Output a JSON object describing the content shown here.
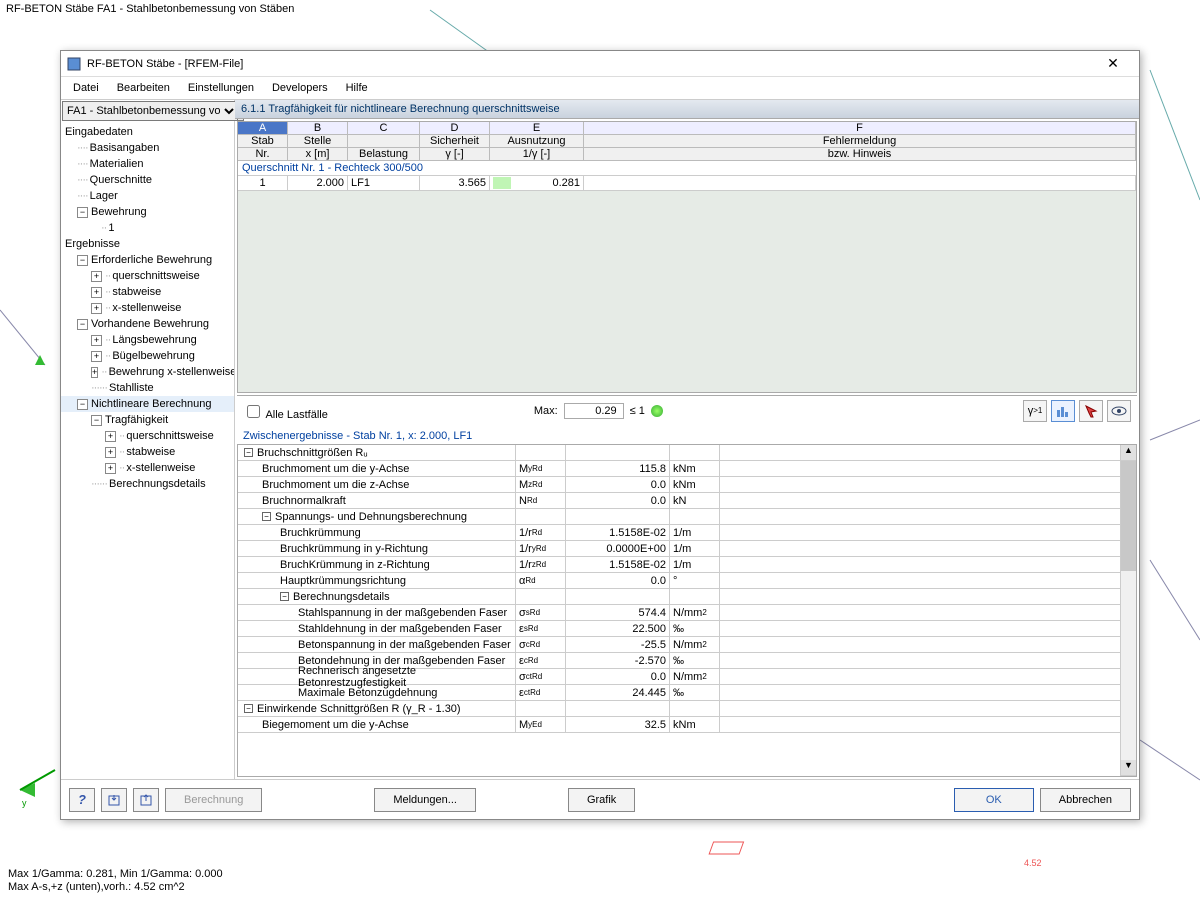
{
  "appTitle": "RF-BETON Stäbe FA1 - Stahlbetonbemessung von Stäben",
  "dialogTitle": "RF-BETON Stäbe - [RFEM-File]",
  "menus": [
    "Datei",
    "Bearbeiten",
    "Einstellungen",
    "Developers",
    "Hilfe"
  ],
  "caseSelect": "FA1 - Stahlbetonbemessung vo",
  "tree": {
    "eingabedaten": "Eingabedaten",
    "basisangaben": "Basisangaben",
    "materialien": "Materialien",
    "querschnitte": "Querschnitte",
    "lager": "Lager",
    "bewehrung": "Bewehrung",
    "bewehrung1": "1",
    "ergebnisse": "Ergebnisse",
    "erforderliche": "Erforderliche Bewehrung",
    "erf_q": "querschnittsweise",
    "erf_s": "stabweise",
    "erf_x": "x-stellenweise",
    "vorhandene": "Vorhandene Bewehrung",
    "vor_l": "Längsbewehrung",
    "vor_b": "Bügelbewehrung",
    "vor_x": "Bewehrung x-stellenweise",
    "vor_st": "Stahlliste",
    "nichtlinear": "Nichtlineare Berechnung",
    "trag": "Tragfähigkeit",
    "trag_q": "querschnittsweise",
    "trag_s": "stabweise",
    "trag_x": "x-stellenweise",
    "details": "Berechnungsdetails"
  },
  "panel": {
    "title": "6.1.1 Tragfähigkeit für nichtlineare Berechnung querschnittsweise",
    "letters": [
      "A",
      "B",
      "C",
      "D",
      "E",
      "F"
    ],
    "head1": [
      "Stab",
      "Stelle",
      "",
      "Sicherheit",
      "Ausnutzung",
      "Fehlermeldung"
    ],
    "head2": [
      "Nr.",
      "x  [m]",
      "Belastung",
      "γ [-]",
      "1/γ [-]",
      "bzw. Hinweis"
    ],
    "sectionRow": "Querschnitt Nr. 1 - Rechteck 300/500",
    "row": {
      "nr": "1",
      "x": "2.000",
      "lf": "LF1",
      "gamma": "3.565",
      "inv": "0.281",
      "msg": ""
    },
    "allLoadcases": "Alle Lastfälle",
    "maxLabel": "Max:",
    "maxVal": "0.29",
    "maxCmp": "≤ 1"
  },
  "detailsTitle": "Zwischenergebnisse  -  Stab Nr. 1,   x: 2.000, LF1",
  "drows": [
    {
      "ind": 0,
      "tog": "⊟",
      "label": "Bruchschnittgrößen Rᵤ",
      "sym": "",
      "val": "",
      "unit": ""
    },
    {
      "ind": 1,
      "label": "Bruchmoment um die y-Achse",
      "sym": "M_yRd",
      "val": "115.8",
      "unit": "kNm"
    },
    {
      "ind": 1,
      "label": "Bruchmoment um die z-Achse",
      "sym": "M_zRd",
      "val": "0.0",
      "unit": "kNm"
    },
    {
      "ind": 1,
      "label": "Bruchnormalkraft",
      "sym": "N_Rd",
      "val": "0.0",
      "unit": "kN"
    },
    {
      "ind": 1,
      "tog": "⊟",
      "label": "Spannungs- und Dehnungsberechnung",
      "sym": "",
      "val": "",
      "unit": ""
    },
    {
      "ind": 2,
      "label": "Bruchkrümmung",
      "sym": "1/r_Rd",
      "val": "1.5158E-02",
      "unit": "1/m"
    },
    {
      "ind": 2,
      "label": "Bruchkrümmung in y-Richtung",
      "sym": "1/r_yRd",
      "val": "0.0000E+00",
      "unit": "1/m"
    },
    {
      "ind": 2,
      "label": "BruchKrümmung in z-Richtung",
      "sym": "1/r_zRd",
      "val": "1.5158E-02",
      "unit": "1/m"
    },
    {
      "ind": 2,
      "label": "Hauptkrümmungsrichtung",
      "sym": "α_Rd",
      "val": "0.0",
      "unit": "°"
    },
    {
      "ind": 2,
      "tog": "⊟",
      "label": "Berechnungsdetails",
      "sym": "",
      "val": "",
      "unit": ""
    },
    {
      "ind": 3,
      "label": "Stahlspannung in der maßgebenden Faser",
      "sym": "σ_sRd",
      "val": "574.4",
      "unit": "N/mm²"
    },
    {
      "ind": 3,
      "label": "Stahldehnung in der maßgebenden Faser",
      "sym": "ε_sRd",
      "val": "22.500",
      "unit": "‰"
    },
    {
      "ind": 3,
      "label": "Betonspannung in der maßgebenden Faser",
      "sym": "σ_cRd",
      "val": "-25.5",
      "unit": "N/mm²"
    },
    {
      "ind": 3,
      "label": "Betondehnung in der maßgebenden Faser",
      "sym": "ε_cRd",
      "val": "-2.570",
      "unit": "‰"
    },
    {
      "ind": 3,
      "label": "Rechnerisch angesetzte Betonrestzugfestigkeit",
      "sym": "σ_ctRd",
      "val": "0.0",
      "unit": "N/mm²"
    },
    {
      "ind": 3,
      "label": "Maximale Betonzugdehnung",
      "sym": "ε_ctRd",
      "val": "24.445",
      "unit": "‰"
    },
    {
      "ind": 0,
      "tog": "⊟",
      "label": "Einwirkende Schnittgrößen R  (γ_R - 1.30)",
      "sym": "",
      "val": "",
      "unit": ""
    },
    {
      "ind": 1,
      "label": "Biegemoment um die y-Achse",
      "sym": "M_yEd",
      "val": "32.5",
      "unit": "kNm"
    }
  ],
  "buttons": {
    "berechnung": "Berechnung",
    "meldungen": "Meldungen...",
    "grafik": "Grafik",
    "ok": "OK",
    "abbrechen": "Abbrechen"
  },
  "status1": "Max 1/Gamma: 0.281, Min 1/Gamma: 0.000",
  "status2": "Max A-s,+z (unten),vorh.: 4.52 cm^2",
  "redLabel": "4.52"
}
